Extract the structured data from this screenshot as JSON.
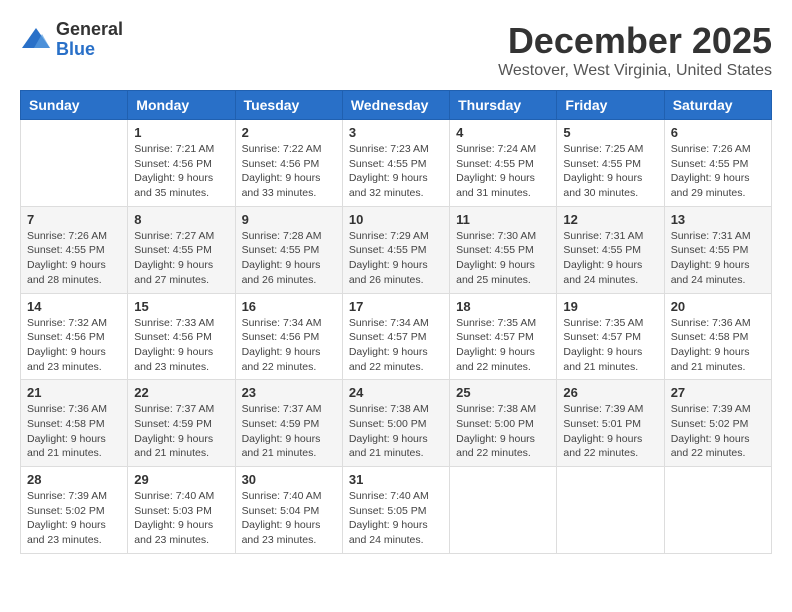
{
  "header": {
    "logo_general": "General",
    "logo_blue": "Blue",
    "month_title": "December 2025",
    "location": "Westover, West Virginia, United States"
  },
  "weekdays": [
    "Sunday",
    "Monday",
    "Tuesday",
    "Wednesday",
    "Thursday",
    "Friday",
    "Saturday"
  ],
  "weeks": [
    [
      {
        "day": "",
        "info": ""
      },
      {
        "day": "1",
        "info": "Sunrise: 7:21 AM\nSunset: 4:56 PM\nDaylight: 9 hours\nand 35 minutes."
      },
      {
        "day": "2",
        "info": "Sunrise: 7:22 AM\nSunset: 4:56 PM\nDaylight: 9 hours\nand 33 minutes."
      },
      {
        "day": "3",
        "info": "Sunrise: 7:23 AM\nSunset: 4:55 PM\nDaylight: 9 hours\nand 32 minutes."
      },
      {
        "day": "4",
        "info": "Sunrise: 7:24 AM\nSunset: 4:55 PM\nDaylight: 9 hours\nand 31 minutes."
      },
      {
        "day": "5",
        "info": "Sunrise: 7:25 AM\nSunset: 4:55 PM\nDaylight: 9 hours\nand 30 minutes."
      },
      {
        "day": "6",
        "info": "Sunrise: 7:26 AM\nSunset: 4:55 PM\nDaylight: 9 hours\nand 29 minutes."
      }
    ],
    [
      {
        "day": "7",
        "info": "Sunrise: 7:26 AM\nSunset: 4:55 PM\nDaylight: 9 hours\nand 28 minutes."
      },
      {
        "day": "8",
        "info": "Sunrise: 7:27 AM\nSunset: 4:55 PM\nDaylight: 9 hours\nand 27 minutes."
      },
      {
        "day": "9",
        "info": "Sunrise: 7:28 AM\nSunset: 4:55 PM\nDaylight: 9 hours\nand 26 minutes."
      },
      {
        "day": "10",
        "info": "Sunrise: 7:29 AM\nSunset: 4:55 PM\nDaylight: 9 hours\nand 26 minutes."
      },
      {
        "day": "11",
        "info": "Sunrise: 7:30 AM\nSunset: 4:55 PM\nDaylight: 9 hours\nand 25 minutes."
      },
      {
        "day": "12",
        "info": "Sunrise: 7:31 AM\nSunset: 4:55 PM\nDaylight: 9 hours\nand 24 minutes."
      },
      {
        "day": "13",
        "info": "Sunrise: 7:31 AM\nSunset: 4:55 PM\nDaylight: 9 hours\nand 24 minutes."
      }
    ],
    [
      {
        "day": "14",
        "info": "Sunrise: 7:32 AM\nSunset: 4:56 PM\nDaylight: 9 hours\nand 23 minutes."
      },
      {
        "day": "15",
        "info": "Sunrise: 7:33 AM\nSunset: 4:56 PM\nDaylight: 9 hours\nand 23 minutes."
      },
      {
        "day": "16",
        "info": "Sunrise: 7:34 AM\nSunset: 4:56 PM\nDaylight: 9 hours\nand 22 minutes."
      },
      {
        "day": "17",
        "info": "Sunrise: 7:34 AM\nSunset: 4:57 PM\nDaylight: 9 hours\nand 22 minutes."
      },
      {
        "day": "18",
        "info": "Sunrise: 7:35 AM\nSunset: 4:57 PM\nDaylight: 9 hours\nand 22 minutes."
      },
      {
        "day": "19",
        "info": "Sunrise: 7:35 AM\nSunset: 4:57 PM\nDaylight: 9 hours\nand 21 minutes."
      },
      {
        "day": "20",
        "info": "Sunrise: 7:36 AM\nSunset: 4:58 PM\nDaylight: 9 hours\nand 21 minutes."
      }
    ],
    [
      {
        "day": "21",
        "info": "Sunrise: 7:36 AM\nSunset: 4:58 PM\nDaylight: 9 hours\nand 21 minutes."
      },
      {
        "day": "22",
        "info": "Sunrise: 7:37 AM\nSunset: 4:59 PM\nDaylight: 9 hours\nand 21 minutes."
      },
      {
        "day": "23",
        "info": "Sunrise: 7:37 AM\nSunset: 4:59 PM\nDaylight: 9 hours\nand 21 minutes."
      },
      {
        "day": "24",
        "info": "Sunrise: 7:38 AM\nSunset: 5:00 PM\nDaylight: 9 hours\nand 21 minutes."
      },
      {
        "day": "25",
        "info": "Sunrise: 7:38 AM\nSunset: 5:00 PM\nDaylight: 9 hours\nand 22 minutes."
      },
      {
        "day": "26",
        "info": "Sunrise: 7:39 AM\nSunset: 5:01 PM\nDaylight: 9 hours\nand 22 minutes."
      },
      {
        "day": "27",
        "info": "Sunrise: 7:39 AM\nSunset: 5:02 PM\nDaylight: 9 hours\nand 22 minutes."
      }
    ],
    [
      {
        "day": "28",
        "info": "Sunrise: 7:39 AM\nSunset: 5:02 PM\nDaylight: 9 hours\nand 23 minutes."
      },
      {
        "day": "29",
        "info": "Sunrise: 7:40 AM\nSunset: 5:03 PM\nDaylight: 9 hours\nand 23 minutes."
      },
      {
        "day": "30",
        "info": "Sunrise: 7:40 AM\nSunset: 5:04 PM\nDaylight: 9 hours\nand 23 minutes."
      },
      {
        "day": "31",
        "info": "Sunrise: 7:40 AM\nSunset: 5:05 PM\nDaylight: 9 hours\nand 24 minutes."
      },
      {
        "day": "",
        "info": ""
      },
      {
        "day": "",
        "info": ""
      },
      {
        "day": "",
        "info": ""
      }
    ]
  ]
}
